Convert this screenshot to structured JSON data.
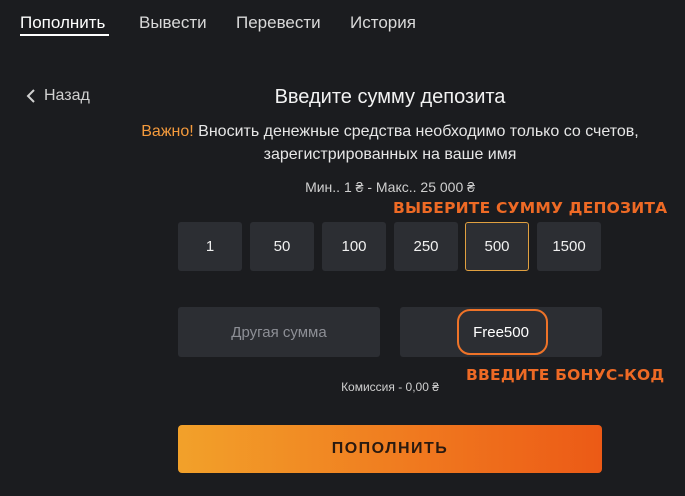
{
  "tabs": [
    {
      "label": "Пополнить",
      "active": true
    },
    {
      "label": "Вывести",
      "active": false
    },
    {
      "label": "Перевести",
      "active": false
    },
    {
      "label": "История",
      "active": false
    }
  ],
  "back": {
    "label": "Назад",
    "icon": "chevron-left-icon"
  },
  "title": "Введите сумму депозита",
  "notice": {
    "important": "Важно!",
    "line1": "Вносить денежные средства необходимо только со счетов,",
    "line2": "зарегистрированных на ваше имя"
  },
  "limits": "Мин.. 1 ₴ - Макс.. 25 000 ₴",
  "annotations": {
    "choose_amount": "ВЫБЕРИТЕ СУММУ ДЕПОЗИТА",
    "enter_bonus": "ВВЕДИТЕ БОНУС-КОД"
  },
  "amounts": [
    "1",
    "50",
    "100",
    "250",
    "500",
    "1500"
  ],
  "selected_amount": "500",
  "other_amount_placeholder": "Другая сумма",
  "bonus_code_value": "Free500",
  "commission": "Комиссия - 0,00 ₴",
  "submit_label": "ПОПОЛНИТЬ",
  "colors": {
    "background": "#1b1c1f",
    "tile": "#2c2e33",
    "accent_orange": "#ee6a25",
    "important": "#f49a3c",
    "selected_border": "#e0a040"
  }
}
